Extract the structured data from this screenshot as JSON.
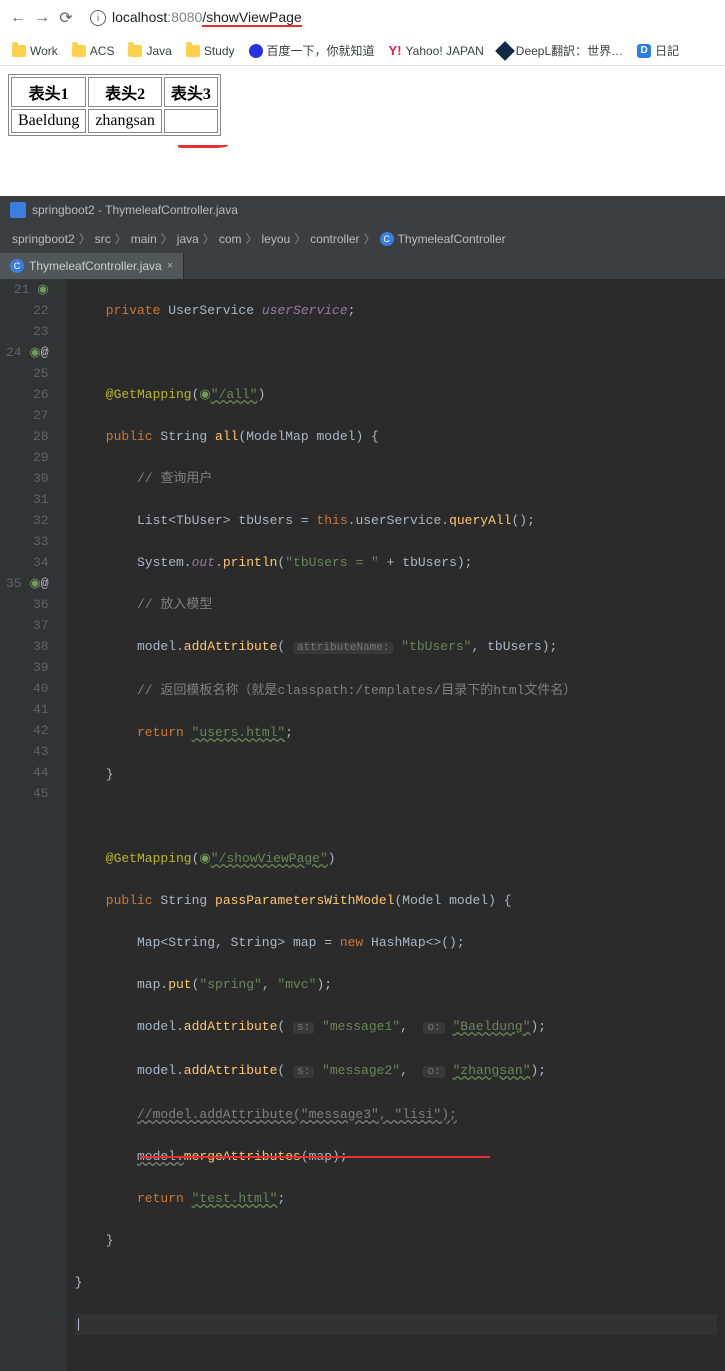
{
  "browser": {
    "url_host": "localhost",
    "url_port": ":8080",
    "url_path": "/showViewPage"
  },
  "bookmarks": {
    "work": "Work",
    "acs": "ACS",
    "java": "Java",
    "study": "Study",
    "baidu": "百度一下，你就知道",
    "yahoo_prefix": "Y!",
    "yahoo": "Yahoo! JAPAN",
    "deepl": "DeepL翻訳：世界…",
    "d_label": "D",
    "d_extra": "日記"
  },
  "table": {
    "headers": [
      "表头1",
      "表头2",
      "表头3"
    ],
    "row1": [
      "Baeldung",
      "zhangsan",
      ""
    ]
  },
  "ide": {
    "title": "springboot2 - ThymeleafController.java",
    "breadcrumbs": [
      "springboot2",
      "src",
      "main",
      "java",
      "com",
      "leyou",
      "controller"
    ],
    "breadcrumb_class": "ThymeleafController",
    "tab": "ThymeleafController.java"
  },
  "code": {
    "line_start": 21,
    "line_end": 45,
    "l21_kw": "private",
    "l21_type": "UserService",
    "l21_fld": "userService",
    "l23_ann": "@GetMapping",
    "l23_str": "\"/all\"",
    "l24_kw": "public",
    "l24_ret": "String",
    "l24_fn": "all",
    "l24_par": "ModelMap model",
    "l25_cmt": "// 查询用户",
    "l26_a": "List<TbUser> tbUsers = ",
    "l26_kw": "this",
    "l26_b": ".userService.",
    "l26_fn": "queryAll",
    "l26_c": "();",
    "l27_a": "System.",
    "l27_fld": "out",
    "l27_b": ".",
    "l27_fn": "println",
    "l27_c": "(",
    "l27_str": "\"tbUsers = \"",
    "l27_d": " + tbUsers);",
    "l28_cmt": "// 放入模型",
    "l29_a": "model.",
    "l29_fn": "addAttribute",
    "l29_hint": "attributeName:",
    "l29_str": "\"tbUsers\"",
    "l29_b": ", tbUsers);",
    "l30_cmt": "// 返回模板名称（就是classpath:/templates/目录下的html文件名）",
    "l31_kw": "return",
    "l31_str": "\"users.html\"",
    "l34_ann": "@GetMapping",
    "l34_str": "\"/showViewPage\"",
    "l35_kw": "public",
    "l35_ret": "String",
    "l35_fn": "passParametersWithModel",
    "l35_par": "Model model",
    "l36_a": "Map<String, String> map = ",
    "l36_kw": "new",
    "l36_b": " HashMap<>();",
    "l37_a": "map.",
    "l37_fn": "put",
    "l37_str1": "\"spring\"",
    "l37_str2": "\"mvc\"",
    "l38_a": "model.",
    "l38_fn": "addAttribute",
    "l38_hint": "s:",
    "l38_str1": "\"message1\"",
    "l38_hint2": "o:",
    "l38_str2": "\"Baeldung\"",
    "l39_a": "model.",
    "l39_fn": "addAttribute",
    "l39_hint": "s:",
    "l39_str1": "\"message2\"",
    "l39_hint2": "o:",
    "l39_str2": "\"zhangsan\"",
    "l40_cmt": "//model.addAttribute(\"message3\", \"lisi\");",
    "l41_a": "model.",
    "l41_fn": "mergeAttributes",
    "l41_b": "(map);",
    "l42_kw": "return",
    "l42_str": "\"test.html\""
  }
}
